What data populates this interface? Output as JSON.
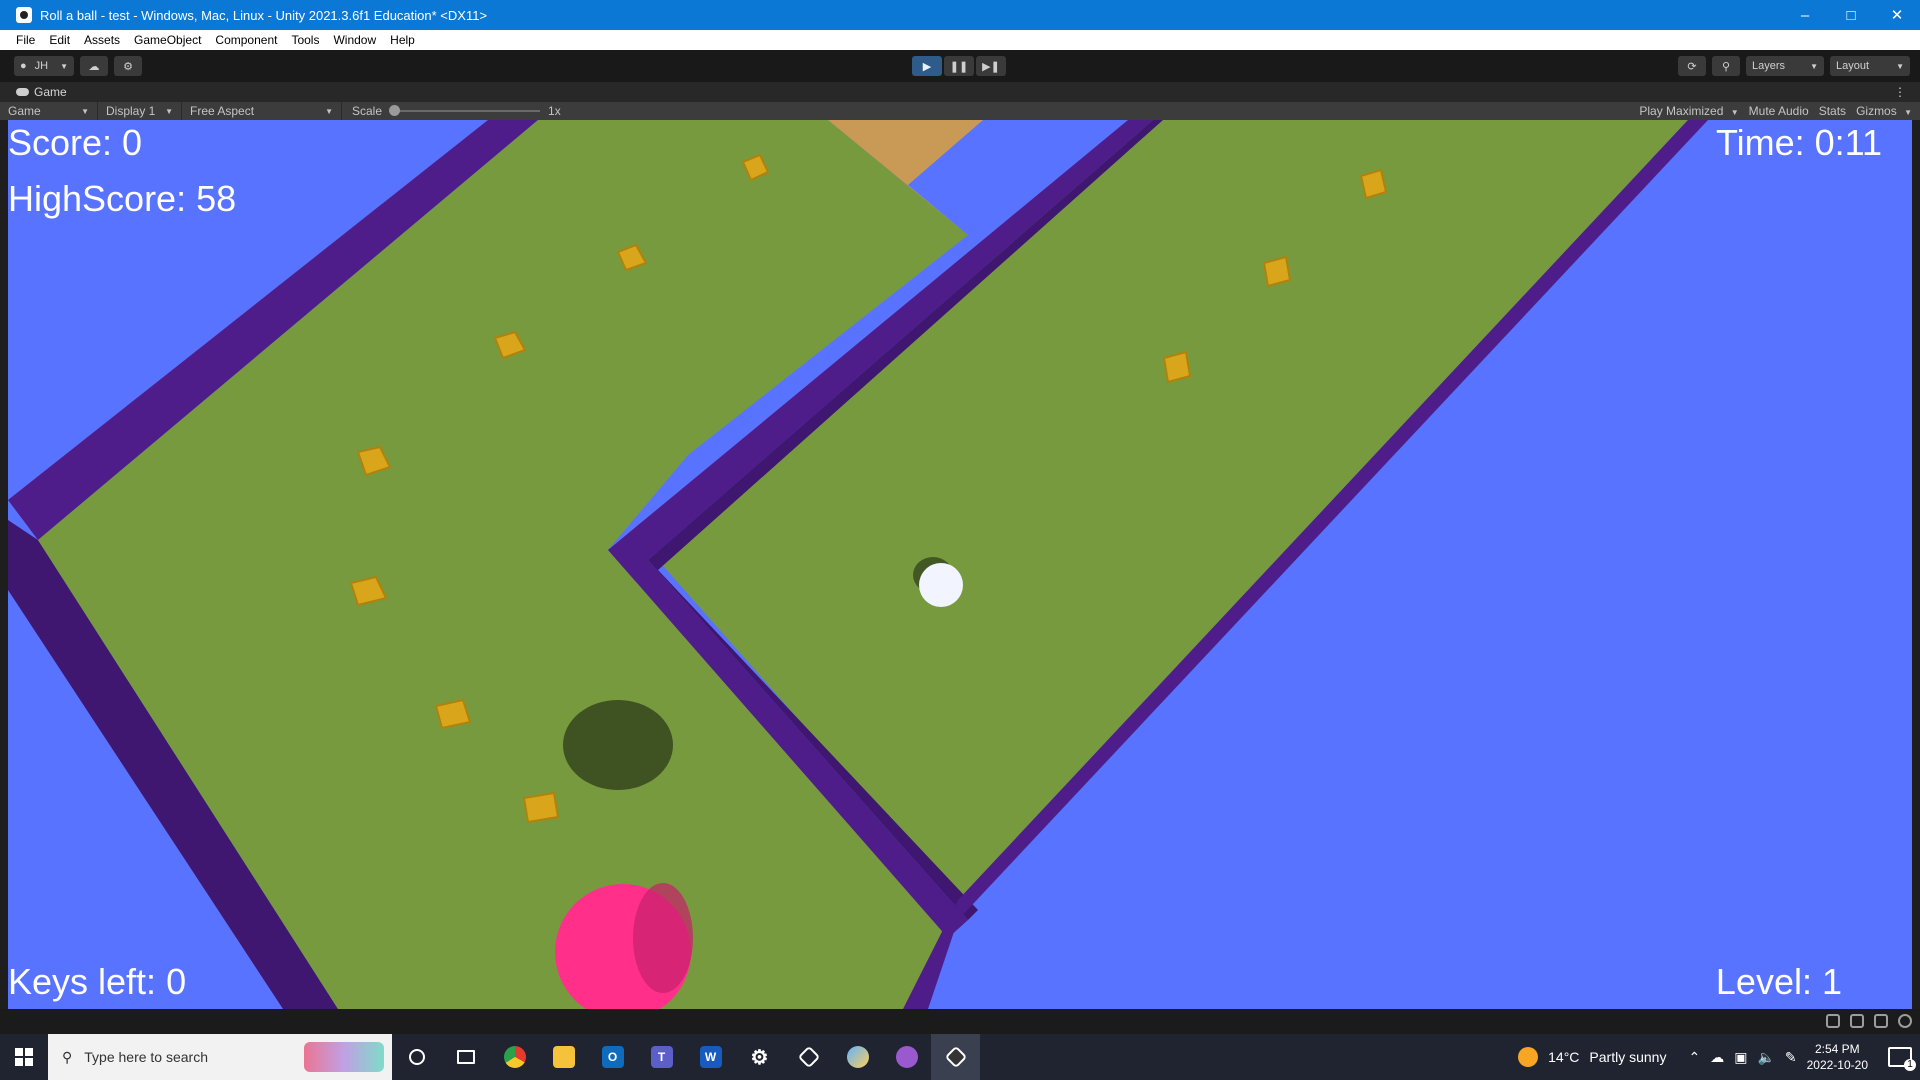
{
  "window": {
    "title": "Roll a ball - test - Windows, Mac, Linux - Unity 2021.3.6f1 Education* <DX11>"
  },
  "menu": [
    "File",
    "Edit",
    "Assets",
    "GameObject",
    "Component",
    "Tools",
    "Window",
    "Help"
  ],
  "toolbar": {
    "account": "JH",
    "layers": "Layers",
    "layout": "Layout"
  },
  "game_tab": {
    "label": "Game"
  },
  "game_controls": {
    "view_mode": "Game",
    "display": "Display 1",
    "aspect": "Free Aspect",
    "scale_label": "Scale",
    "scale_value": "1x",
    "play_mode": "Play Maximized",
    "mute_audio": "Mute Audio",
    "stats": "Stats",
    "gizmos": "Gizmos"
  },
  "hud": {
    "score": "Score: 0",
    "highscore": "HighScore: 58",
    "time": "Time: 0:11",
    "keys_left": "Keys left: 0",
    "level": "Level: 1"
  },
  "colors": {
    "sky": "#5873ff",
    "ground": "#789a3f",
    "wall": "#4e1d8a",
    "pickup": "#d9a51a",
    "player": "#ff2f8a"
  },
  "taskbar": {
    "search_placeholder": "Type here to search",
    "apps": [
      "cortana-icon",
      "task-view-icon",
      "chrome-icon",
      "file-explorer-icon",
      "outlook-icon",
      "teams-icon",
      "word-icon",
      "settings-icon",
      "unity-hub-icon",
      "paint-icon",
      "github-icon",
      "unity-editor-icon"
    ],
    "weather_temp": "14°C",
    "weather_text": "Partly sunny",
    "time": "2:54 PM",
    "date": "2022-10-20",
    "notification_count": "1"
  }
}
